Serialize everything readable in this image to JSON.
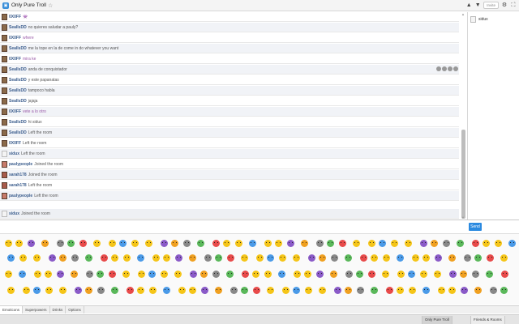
{
  "topbar": {
    "title": "Only Pure Troll",
    "like_label": "Invite"
  },
  "messages": [
    {
      "author": "0X0FF",
      "text": "👾",
      "style": ""
    },
    {
      "author": "0X0FF",
      "text": "no quieres saludar a pauly?",
      "style": "",
      "author_first": false
    },
    {
      "author": "0X0FF",
      "text": "where",
      "style": "mauve"
    },
    {
      "author": "SeallsDD",
      "text": "me la tope en la de come in do whatever you want",
      "style": ""
    },
    {
      "author": "0X0FF",
      "text": "mira ke",
      "style": "mauve"
    },
    {
      "author": "SeallsDD",
      "text": "anda de conquistador",
      "style": ""
    },
    {
      "author": "SeallsDD",
      "text": "y este papanatas",
      "style": ""
    },
    {
      "author": "SeallsDD",
      "text": "tampoco habla",
      "style": ""
    },
    {
      "author": "SeallsDD",
      "text": "jajaja",
      "style": ""
    },
    {
      "author": "0X0FF",
      "text": "vete a lo otro",
      "style": "mauve"
    },
    {
      "author": "SeallsDD",
      "text": "hi sidux",
      "style": ""
    },
    {
      "author": "SeallsDD",
      "text": "Left the room",
      "style": ""
    },
    {
      "author": "0X0FF",
      "text": "Left the room",
      "style": ""
    },
    {
      "author": "sidux",
      "text": "Left the room",
      "style": ""
    },
    {
      "author": "paulypeople",
      "text": "Joined the room",
      "style": ""
    },
    {
      "author": "sarah178",
      "text": "Joined the room",
      "style": ""
    },
    {
      "author": "sarah178",
      "text": "Left the room",
      "style": ""
    },
    {
      "author": "paulypeople",
      "text": "Left the room",
      "style": ""
    },
    {
      "author": "sidux",
      "text": "Joined the room",
      "style": ""
    }
  ],
  "messages_authors_mixed": [
    "0X0FF",
    "SeallsDD",
    "0X0FF",
    "SeallsDD",
    "0X0FF",
    "SeallsDD",
    "SeallsDD",
    "SeallsDD",
    "SeallsDD",
    "0X0FF",
    "SeallsDD",
    "SeallsDD",
    "0X0FF",
    "sidux",
    "paulypeople",
    "sarah178",
    "sarah178",
    "paulypeople",
    "sidux"
  ],
  "userlist": {
    "users": [
      {
        "name": "sidux"
      }
    ]
  },
  "input": {
    "value": "",
    "send_label": "Send"
  },
  "emote_tabs": [
    "Emoticons",
    "Superpowers",
    "Drinks",
    "Options"
  ],
  "bottombar": {
    "room_tab": "Only Pure Troll",
    "friends_tab": "Friends & Rooms"
  },
  "colors": {
    "accent": "#2b8ae0",
    "author": "#3a5c8c",
    "mauve_text": "#9a5aa8",
    "alt_row": "#f1f3f7"
  },
  "icons": {
    "room": "chat-room-icon",
    "favorite": "star-icon",
    "settings": "gear-icon",
    "fullscreen": "fullscreen-icon"
  }
}
